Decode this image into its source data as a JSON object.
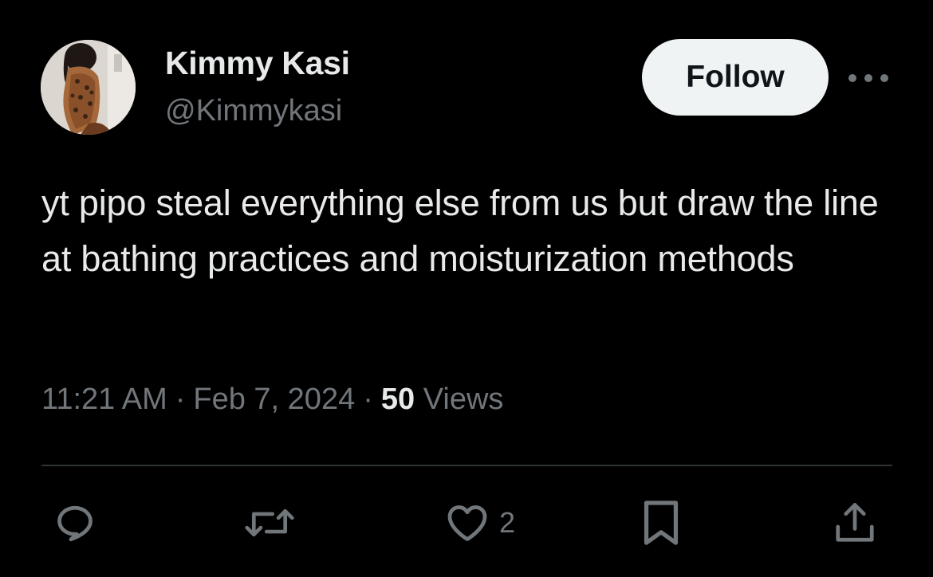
{
  "author": {
    "display_name": "Kimmy Kasi",
    "handle": "@Kimmykasi"
  },
  "follow_label": "Follow",
  "tweet": {
    "text": "yt pipo steal everything else from us but draw the line at bathing practices and moisturization methods",
    "time": "11:21 AM",
    "date": "Feb 7, 2024",
    "separator": "·",
    "views_count": "50",
    "views_label": "Views"
  },
  "actions": {
    "like_count": "2"
  },
  "icons": {
    "more": "more-horizontal-icon",
    "reply": "reply-icon",
    "retweet": "retweet-icon",
    "like": "heart-icon",
    "bookmark": "bookmark-icon",
    "share": "share-icon"
  },
  "colors": {
    "background": "#000000",
    "primary_text": "#e7e9ea",
    "secondary_text": "#71767b",
    "follow_button_bg": "#eff3f4",
    "divider": "#2f3336"
  }
}
